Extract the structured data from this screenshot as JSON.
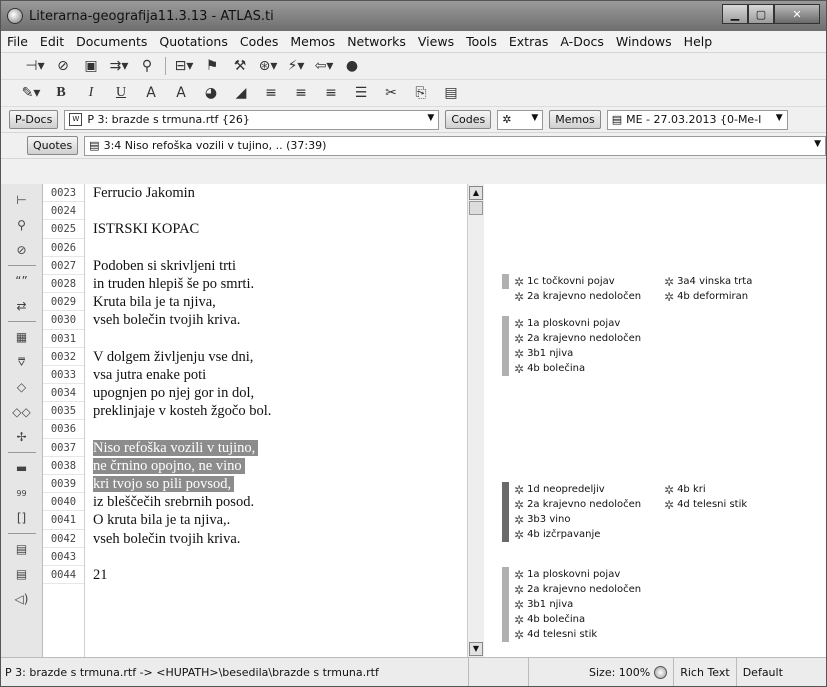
{
  "window": {
    "title": "Literarna-geografija11.3.13 - ATLAS.ti"
  },
  "menu": [
    "File",
    "Edit",
    "Documents",
    "Quotations",
    "Codes",
    "Memos",
    "Networks",
    "Views",
    "Tools",
    "Extras",
    "A-Docs",
    "Windows",
    "Help"
  ],
  "selectors": {
    "pdocs_label": "P-Docs",
    "pdoc_value": "P 3: brazde s trmuna.rtf {26}",
    "codes_label": "Codes",
    "memos_label": "Memos",
    "memo_value": "ME - 27.03.2013 {0-Me-I",
    "quotes_label": "Quotes",
    "quote_value": "3:4 Niso refoška vozili v tujino, .. (37:39)"
  },
  "lines": [
    {
      "num": "0023",
      "text": "Ferrucio Jakomin"
    },
    {
      "num": "0024",
      "text": ""
    },
    {
      "num": "0025",
      "text": "ISTRSKI KOPAC"
    },
    {
      "num": "0026",
      "text": ""
    },
    {
      "num": "0027",
      "text": "Podoben si skrivljeni trti"
    },
    {
      "num": "0028",
      "text": "in truden hlepiš še po smrti."
    },
    {
      "num": "0029",
      "text": "Kruta bila je ta njiva,"
    },
    {
      "num": "0030",
      "text": "vseh bolečin tvojih kriva."
    },
    {
      "num": "0031",
      "text": ""
    },
    {
      "num": "0032",
      "text": "V dolgem življenju vse dni,"
    },
    {
      "num": "0033",
      "text": "vsa jutra enake poti"
    },
    {
      "num": "0034",
      "text": "upognjen po njej gor in dol,"
    },
    {
      "num": "0035",
      "text": "preklinjaje v kosteh žgočo bol."
    },
    {
      "num": "0036",
      "text": ""
    },
    {
      "num": "0037",
      "text": "Niso refoška vozili v tujino,"
    },
    {
      "num": "0038",
      "text": "ne črnino opojno, ne vino"
    },
    {
      "num": "0039",
      "text": "kri tvojo so pili povsod,"
    },
    {
      "num": "0040",
      "text": "iz bleščečih srebrnih posod."
    },
    {
      "num": "0041",
      "text": "O kruta bila je ta njiva,."
    },
    {
      "num": "0042",
      "text": "vseh bolečin tvojih kriva."
    },
    {
      "num": "0043",
      "text": ""
    },
    {
      "num": "0044",
      "text": "21"
    }
  ],
  "margin_codes": {
    "g1": [
      [
        "1c točkovni pojav",
        "3a4 vinska trta"
      ],
      [
        "2a krajevno nedoločen",
        "4b deformiran"
      ]
    ],
    "g2": [
      [
        "1a ploskovni pojav",
        ""
      ],
      [
        "2a krajevno nedoločen",
        ""
      ],
      [
        "3b1 njiva",
        ""
      ],
      [
        "4b bolečina",
        ""
      ]
    ],
    "g3": [
      [
        "1d neopredeljiv",
        "4b kri"
      ],
      [
        "2a krajevno nedoločen",
        "4d telesni stik"
      ],
      [
        "3b3 vino",
        ""
      ],
      [
        "4b izčrpavanje",
        ""
      ]
    ],
    "g4": [
      [
        "1a ploskovni pojav",
        ""
      ],
      [
        "2a krajevno nedoločen",
        ""
      ],
      [
        "3b1 njiva",
        ""
      ],
      [
        "4b bolečina",
        ""
      ],
      [
        "4d telesni stik",
        ""
      ]
    ]
  },
  "status": {
    "path": "P 3: brazde s trmuna.rtf -> <HUPATH>\\besedila\\brazde s trmuna.rtf",
    "size": "Size: 100%",
    "format": "Rich Text",
    "mode": "Default"
  },
  "colors": {
    "highlight": "#8c8c8c",
    "bar_light": "#b0b0b0",
    "bar_dark": "#6a6a6a"
  }
}
